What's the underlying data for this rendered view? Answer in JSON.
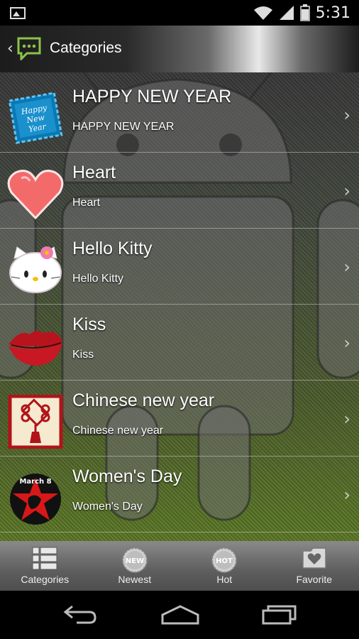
{
  "status_bar": {
    "time": "5:31",
    "icons": [
      "image-icon",
      "wifi-icon",
      "signal-icon",
      "battery-icon"
    ]
  },
  "action_bar": {
    "title": "Categories",
    "icons": [
      "back-chevron-icon",
      "chat-bubble-icon"
    ]
  },
  "categories": [
    {
      "title": "HAPPY NEW YEAR",
      "subtitle": "HAPPY NEW YEAR",
      "icon": "happy-new-year-stamp-icon"
    },
    {
      "title": "Heart",
      "subtitle": "Heart",
      "icon": "heart-icon"
    },
    {
      "title": "Hello Kitty",
      "subtitle": "Hello Kitty",
      "icon": "hello-kitty-icon"
    },
    {
      "title": "Kiss",
      "subtitle": "Kiss",
      "icon": "lips-icon"
    },
    {
      "title": "Chinese new year",
      "subtitle": "Chinese new year",
      "icon": "chinese-knot-icon"
    },
    {
      "title": "Women's Day",
      "subtitle": "Women's Day",
      "icon": "march-8-star-icon"
    }
  ],
  "thumb_texts": {
    "happy_new_year": [
      "Happy",
      "New",
      "Year"
    ],
    "march8": "March 8"
  },
  "tabs": [
    {
      "label": "Categories",
      "icon": "list-icon"
    },
    {
      "label": "Newest",
      "icon": "new-badge-icon",
      "badge": "NEW"
    },
    {
      "label": "Hot",
      "icon": "hot-badge-icon",
      "badge": "HOT"
    },
    {
      "label": "Favorite",
      "icon": "favorite-folder-icon"
    }
  ],
  "nav_bar": {
    "buttons": [
      "back-icon",
      "home-icon",
      "recents-icon"
    ]
  },
  "colors": {
    "accent_green": "#8bc34a",
    "text": "#ffffff",
    "tab_bar": "#6a6a6a"
  }
}
